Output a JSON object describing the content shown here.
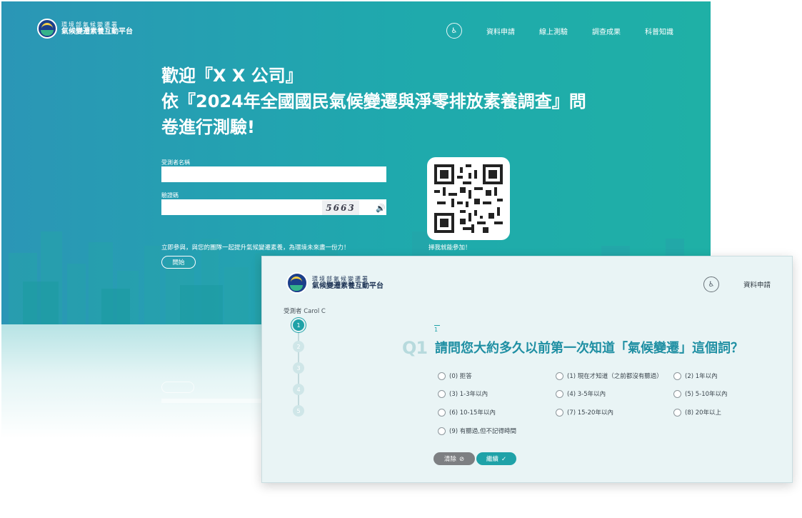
{
  "landing": {
    "logo": {
      "line1": "環境部氣候變遷署",
      "line2": "氣候變遷素養互動平台"
    },
    "nav": {
      "icon": "accessibility-icon",
      "items": [
        "資料申請",
        "線上測驗",
        "調查成果",
        "科普知識"
      ]
    },
    "hero": {
      "line1": "歡迎『X X 公司』",
      "line2": "依『2024年全國國民氣候變遷與淨零排放素養調查』問",
      "line3": "卷進行測驗!"
    },
    "form": {
      "name_label": "受測者名稱",
      "code_label": "驗證碼",
      "captcha": "5663",
      "refresh_icon": "refresh-icon",
      "audio_icon": "speaker-icon"
    },
    "promo": "立即參與，與您的團隊一起提升氣候變遷素養，為環境未來盡一份力！",
    "start_button": "開始",
    "qr_caption": "掃我就能參加！"
  },
  "quiz": {
    "logo": {
      "line1": "環境部氣候變遷署",
      "line2": "氣候變遷素養互動平台"
    },
    "nav": {
      "icon": "accessibility-icon",
      "item": "資料申請"
    },
    "tester": "受測者 Carol C",
    "steps": [
      "1",
      "2",
      "3",
      "4",
      "5"
    ],
    "active_step": 1,
    "question_index": "1",
    "question_no": "Q1",
    "question": "請問您大約多久以前第一次知道「氣候變遷」這個詞？",
    "options": [
      "(0) 拒答",
      "(1) 現在才知道（之前都沒有聽過）",
      "(2) 1年以內",
      "(3) 1-3年以內",
      "(4) 3-5年以內",
      "(5) 5-10年以內",
      "(6) 10-15年以內",
      "(7) 15-20年以內",
      "(8) 20年以上",
      "(9) 有聽過,但不記得時間"
    ],
    "clear_button": "清除",
    "next_button": "繼續"
  },
  "colors": {
    "brand_teal": "#1fa2a8",
    "gradient_left": "#2b96b6",
    "gradient_right": "#1fb0a6",
    "question_text": "#1f8fa3"
  }
}
